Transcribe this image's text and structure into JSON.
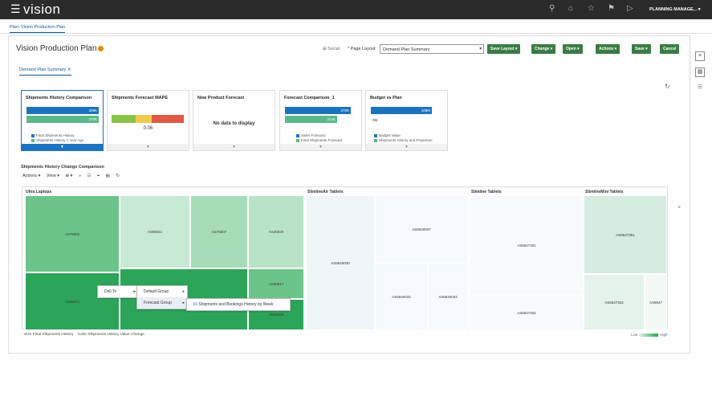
{
  "topbar": {
    "menu_icon": "☰",
    "logo": "vision",
    "user": "PLANNING MANAGE... ▾"
  },
  "tabs": {
    "main": "Plan: Vision Production Plan"
  },
  "header": {
    "title": "Vision Production Plan",
    "social": "Social",
    "page_layout_label": "* Page Layout",
    "page_layout_value": "Demand Plan Summary"
  },
  "buttons": {
    "save_layout": "Save Layout",
    "change": "Change",
    "open": "Open",
    "actions": "Actions",
    "save": "Save",
    "cancel": "Cancel"
  },
  "subtab": "Demand Plan Summary",
  "cards": [
    {
      "title": "Shipments History Comparison",
      "bar1": "209K",
      "bar2": "270K",
      "legend1": "Final Shipments History",
      "legend2": "Shipments History 1 Year Ago"
    },
    {
      "title": "Shipments Forecast MAPE",
      "value": "0.06"
    },
    {
      "title": "New Product Forecast",
      "message": "No data to display"
    },
    {
      "title": "Forecast Comparison_1",
      "bar1": "270K",
      "bar2": "214K",
      "legend1": "Sales Forecast",
      "legend2": "Final Shipments Forecast"
    },
    {
      "title": "Budget vs Plan",
      "bar1": "108M",
      "bar2": "0M",
      "legend1": "Budget Value",
      "legend2": "Shipments History and Projection"
    }
  ],
  "section": {
    "title": "Shipments History Change Comparison",
    "actions": "Actions ▾",
    "view": "View ▾"
  },
  "treemap": {
    "groups": [
      "Ultra Laptops",
      "SlimlineAir Tablets",
      "Slimline Tablets",
      "SlimlineMini Tablets"
    ],
    "cells": [
      "AS75001",
      "AS65011",
      "AS75007",
      "AS20020",
      "AS65071",
      "AS20017",
      "AS20026",
      "AS6640030",
      "AS6640037",
      "AS6640032",
      "AS6640034",
      "AS6647401",
      "AS6647402",
      "AS6647301",
      "AS6647302",
      "AS6647"
    ]
  },
  "context_menu": {
    "drill_to": "Drill To",
    "default_group": "Default Group",
    "forecast_group": "Forecast Group",
    "item": "Shipments and Bookings History by Week"
  },
  "footer": {
    "size_label": "Size",
    "size_value": "Final Shipments History",
    "color_label": "Color",
    "color_value": "Shipments History Value Change",
    "low": "Low",
    "high": "High"
  },
  "colors": {
    "green_dark": "#2ca55a",
    "green_mid": "#6cc48a",
    "green_light": "#c8e9d3",
    "blue": "#1e73be",
    "teal": "#5bb88a"
  }
}
